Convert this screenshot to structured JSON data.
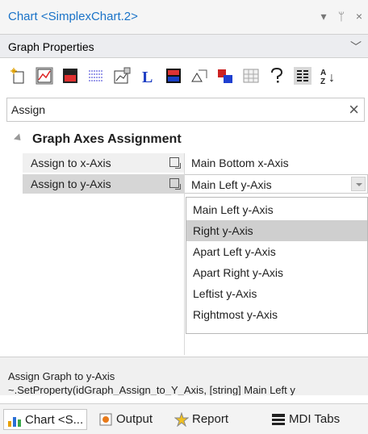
{
  "window": {
    "title": "Chart <SimplexChart.2>",
    "controls": {
      "dropdown": "▾",
      "pin": "ᛘ",
      "close": "×"
    }
  },
  "combo": {
    "selected": "Graph Properties"
  },
  "toolbar": {
    "icons": [
      "new-icon",
      "graph-props-icon",
      "graph-color-icon",
      "hatch-icon",
      "axis-props-icon",
      "legend-icon",
      "colors-icon",
      "export-icon",
      "clone-icon",
      "table-icon",
      "help-icon",
      "categorized-icon",
      "sort-az-icon"
    ],
    "legend_letter": "L",
    "sort_glyph": "↓"
  },
  "search": {
    "value": "Assign",
    "clear": "×"
  },
  "grid": {
    "category": "Graph Axes Assignment",
    "rows": [
      {
        "name": "Assign to x-Axis",
        "value": "Main Bottom x-Axis"
      },
      {
        "name": "Assign to y-Axis",
        "value": "Main Left y-Axis"
      }
    ]
  },
  "dropdown": {
    "options": [
      "Main Left y-Axis",
      "Right y-Axis",
      "Apart Left y-Axis",
      "Apart Right y-Axis",
      "Leftist y-Axis",
      "Rightmost y-Axis"
    ],
    "highlighted": "Right y-Axis"
  },
  "description": {
    "title": "Assign Graph to y-Axis",
    "code": "~.SetProperty(idGraph_Assign_to_Y_Axis, [string] Main Left y"
  },
  "bottom_tabs": [
    {
      "label": "Chart <S...",
      "icon": "chart-icon",
      "active": true
    },
    {
      "label": "Output",
      "icon": "output-icon",
      "active": false
    },
    {
      "label": "Report",
      "icon": "report-icon",
      "active": false
    },
    {
      "label": "MDI Tabs",
      "icon": "mdi-tabs-icon",
      "active": false
    }
  ],
  "colors": {
    "accent": "#1a73c8",
    "selected_row": "#d6d6d6",
    "highlight": "#cfcfcf"
  }
}
